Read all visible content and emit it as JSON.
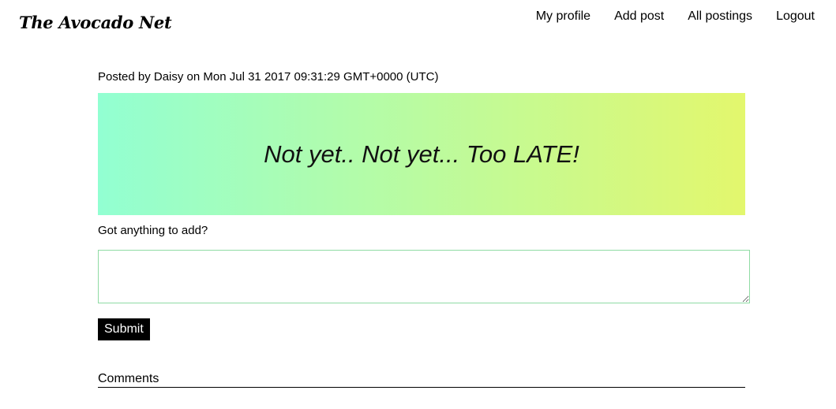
{
  "header": {
    "logo": "The Avocado Net",
    "nav": [
      "My profile",
      "Add post",
      "All postings",
      "Logout"
    ]
  },
  "post": {
    "byline": "Posted by Daisy on Mon Jul 31 2017 09:31:29 GMT+0000 (UTC)",
    "text": "Not yet.. Not yet... Too LATE!",
    "gradient_start": "#92ffd2",
    "gradient_end": "#e3f76d"
  },
  "comment_form": {
    "label": "Got anything to add?",
    "value": "",
    "border_color": "#8fdba4",
    "submit_label": "Submit",
    "submit_bg": "#000000"
  },
  "comments": {
    "heading": "Comments"
  }
}
